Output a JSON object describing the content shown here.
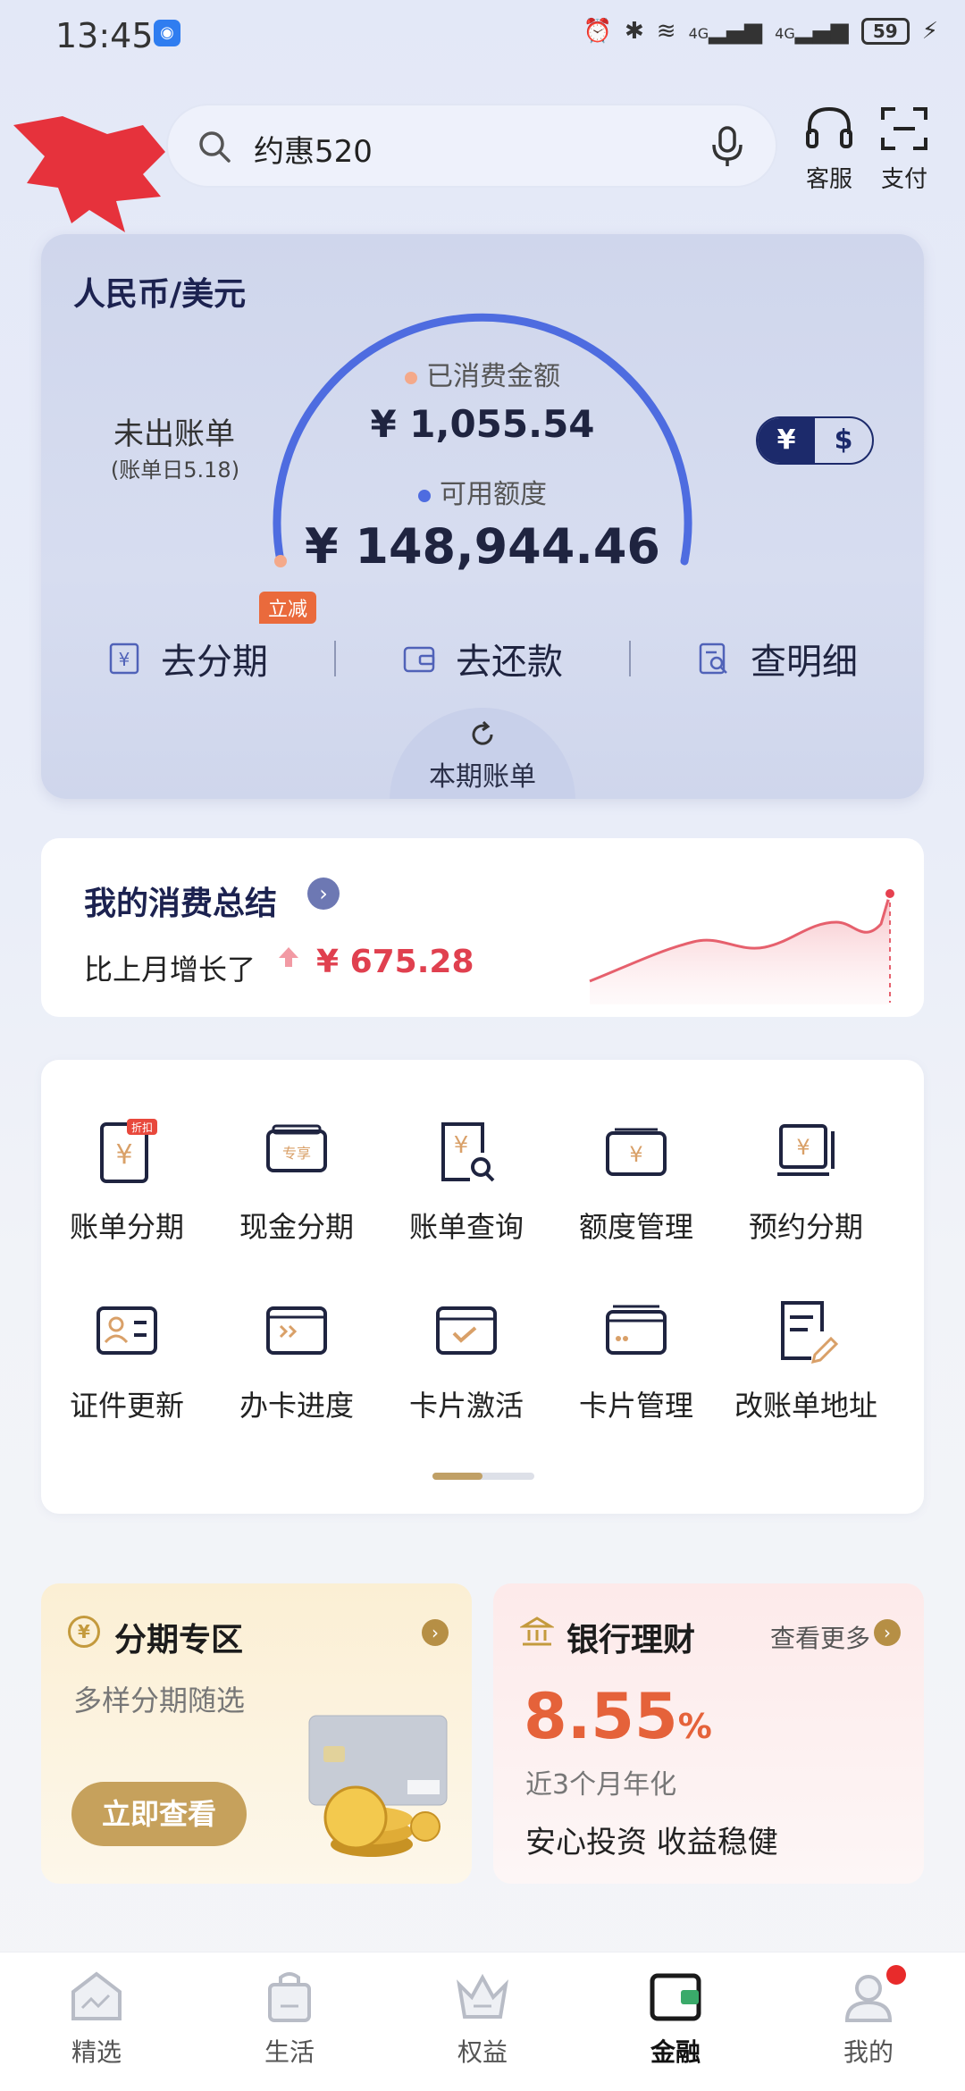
{
  "status_bar": {
    "time": "13:45",
    "signal_1": "4G",
    "signal_2": "4G",
    "battery": "59"
  },
  "header": {
    "search_text": "约惠520",
    "service_label": "客服",
    "pay_label": "支付"
  },
  "bill_card": {
    "title": "人民币/美元",
    "unpaid_label": "未出账单",
    "bill_date": "(账单日5.18)",
    "spent_label": "已消费金额",
    "spent_amount": "¥ 1,055.54",
    "available_label": "可用额度",
    "available_amount": "¥ 148,944.46",
    "currency_cny": "¥",
    "currency_usd": "$",
    "promo_tag": "立减",
    "actions": [
      {
        "label": "去分期",
        "icon": "installment-icon"
      },
      {
        "label": "去还款",
        "icon": "wallet-icon"
      },
      {
        "label": "查明细",
        "icon": "details-icon"
      }
    ],
    "period_tab_label": "本期账单",
    "gauge_used_fraction": 0.007,
    "accent_color": "#4e6ce0",
    "spent_dot_color": "#f4a98a"
  },
  "summary": {
    "title": "我的消费总结",
    "subtitle": "比上月增长了",
    "amount": "¥ 675.28",
    "amount_color": "#e0404f"
  },
  "services": {
    "row1": [
      {
        "label": "账单分期",
        "badge": "折扣",
        "icon": "bill-installment-icon"
      },
      {
        "label": "现金分期",
        "badge": "专享",
        "icon": "cash-installment-icon"
      },
      {
        "label": "账单查询",
        "icon": "bill-query-icon"
      },
      {
        "label": "额度管理",
        "icon": "limit-management-icon"
      },
      {
        "label": "预约分期",
        "icon": "scheduled-installment-icon"
      }
    ],
    "row2": [
      {
        "label": "证件更新",
        "icon": "id-card-icon"
      },
      {
        "label": "办卡进度",
        "icon": "card-progress-icon"
      },
      {
        "label": "卡片激活",
        "icon": "card-activate-icon"
      },
      {
        "label": "卡片管理",
        "icon": "card-manage-icon"
      },
      {
        "label": "改账单地址",
        "icon": "edit-address-icon"
      }
    ]
  },
  "promo_installment": {
    "icon_glyph": "¥",
    "title": "分期专区",
    "subtitle": "多样分期随选",
    "button": "立即查看"
  },
  "promo_wealth": {
    "title": "银行理财",
    "more": "查看更多",
    "rate": "8.55",
    "rate_unit": "%",
    "rate_label": "近3个月年化",
    "slogan": "安心投资 收益稳健"
  },
  "bottom_nav": [
    {
      "label": "精选",
      "icon": "featured-icon"
    },
    {
      "label": "生活",
      "icon": "life-bag-icon"
    },
    {
      "label": "权益",
      "icon": "crown-icon"
    },
    {
      "label": "金融",
      "icon": "finance-wallet-icon",
      "active": true
    },
    {
      "label": "我的",
      "icon": "profile-icon"
    }
  ]
}
